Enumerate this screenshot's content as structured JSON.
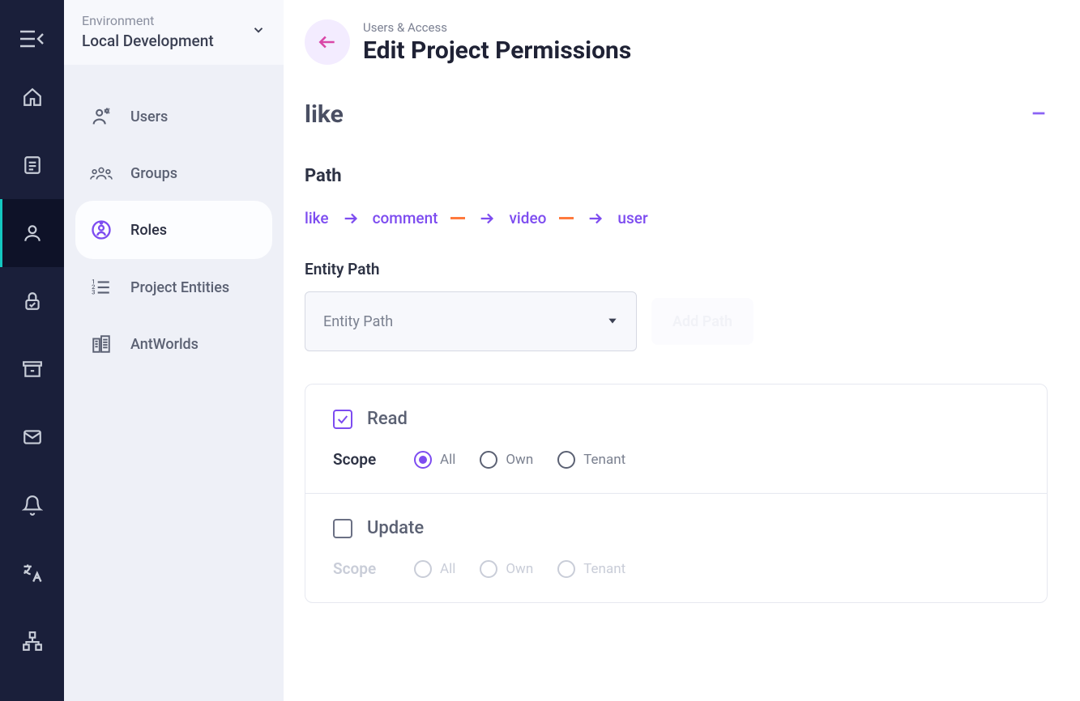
{
  "env": {
    "label": "Environment",
    "value": "Local Development"
  },
  "nav": {
    "items": [
      {
        "label": "Users",
        "icon": "users-cog-icon"
      },
      {
        "label": "Groups",
        "icon": "groups-icon"
      },
      {
        "label": "Roles",
        "icon": "role-icon"
      },
      {
        "label": "Project Entities",
        "icon": "list-icon"
      },
      {
        "label": "AntWorlds",
        "icon": "buildings-icon"
      }
    ]
  },
  "header": {
    "breadcrumb": "Users & Access",
    "title": "Edit Project Permissions"
  },
  "section": {
    "title": "like",
    "path_label": "Path",
    "path": [
      "like",
      "comment",
      "video",
      "user"
    ],
    "entity_path_label": "Entity Path",
    "entity_path_placeholder": "Entity Path",
    "add_path_label": "Add Path"
  },
  "permissions": [
    {
      "name": "Read",
      "checked": true,
      "scope_label": "Scope",
      "enabled": true,
      "scopes": [
        {
          "label": "All",
          "selected": true
        },
        {
          "label": "Own",
          "selected": false
        },
        {
          "label": "Tenant",
          "selected": false
        }
      ]
    },
    {
      "name": "Update",
      "checked": false,
      "scope_label": "Scope",
      "enabled": false,
      "scopes": [
        {
          "label": "All",
          "selected": false
        },
        {
          "label": "Own",
          "selected": false
        },
        {
          "label": "Tenant",
          "selected": false
        }
      ]
    }
  ]
}
